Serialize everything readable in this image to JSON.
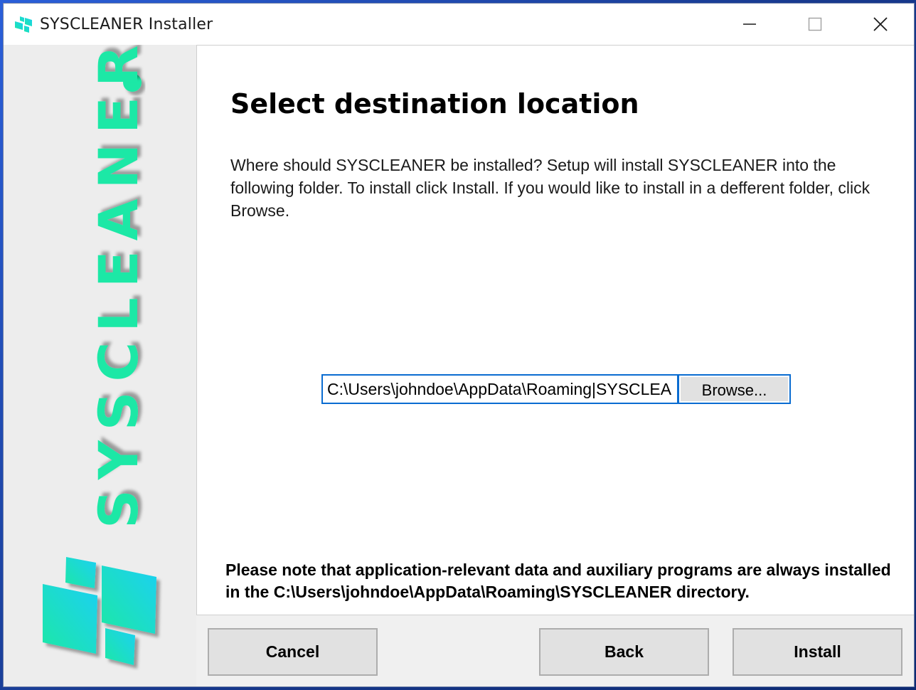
{
  "window": {
    "title": "SYSCLEANER Installer",
    "controls": [
      "minimize",
      "maximize",
      "close"
    ]
  },
  "sidebar": {
    "brand_text": "SYSCLEANER",
    "brand_color": "#1ee8a6",
    "logo": "syscleaner-tiles-logo"
  },
  "page": {
    "title": "Select destination location",
    "description": "Where should SYSCLEANER be installed? Setup will install SYSCLEANER into the following folder. To install click Install. If you would like to install in a defferent folder, click Browse.",
    "path_value": "C:\\Users\\johndoe\\AppData\\Roaming|SYSCLEANER",
    "browse_label": "Browse...",
    "note": "Please note that application-relevant data and auxiliary programs are always installed in the C:\\Users\\johndoe\\AppData\\Roaming\\SYSCLEANER directory."
  },
  "footer": {
    "cancel_label": "Cancel",
    "back_label": "Back",
    "install_label": "Install"
  }
}
